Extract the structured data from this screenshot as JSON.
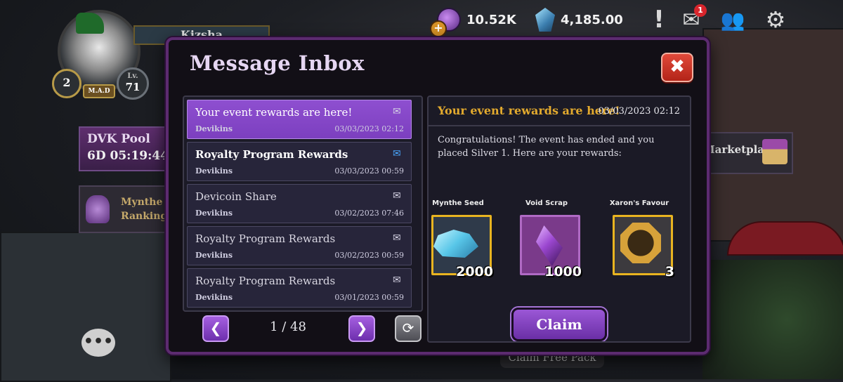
{
  "hud": {
    "currency1": "10.52K",
    "currency2": "4,185.00",
    "mail_badge": "1",
    "plus_symbol": "+"
  },
  "profile": {
    "name": "Kizsha",
    "rank": "2",
    "level_label": "Lv.",
    "level": "71",
    "guild": "M.A.D"
  },
  "side": {
    "dvk_title": "DVK Pool",
    "dvk_time": "6D 05:19:44",
    "mynthe_line1": "Mynthe",
    "mynthe_line2": "Ranking",
    "marketplace": "Marketplace"
  },
  "bottom": {
    "claim_free_pack": "Claim Free Pack"
  },
  "modal": {
    "title": "Message Inbox",
    "close_symbol": "✖",
    "pagination": {
      "current": 1,
      "total": 48,
      "label": "1 / 48",
      "prev": "❮",
      "next": "❯",
      "refresh": "⟳"
    },
    "messages": [
      {
        "title": "Your event rewards are here!",
        "sender": "Devikins",
        "date": "03/03/2023 02:12",
        "read": true,
        "active": true
      },
      {
        "title": "Royalty Program Rewards",
        "sender": "Devikins",
        "date": "03/03/2023 00:59",
        "read": false,
        "active": false
      },
      {
        "title": "Devicoin Share",
        "sender": "Devikins",
        "date": "03/02/2023 07:46",
        "read": true,
        "active": false
      },
      {
        "title": "Royalty Program Rewards",
        "sender": "Devikins",
        "date": "03/02/2023 00:59",
        "read": true,
        "active": false
      },
      {
        "title": "Royalty Program Rewards",
        "sender": "Devikins",
        "date": "03/01/2023 00:59",
        "read": true,
        "active": false
      }
    ],
    "detail": {
      "title": "Your event rewards are here!",
      "date": "03/03/2023 02:12",
      "body": "Congratulations! The event has ended and you placed Silver 1. Here are your rewards:",
      "rewards": [
        {
          "name": "Mynthe Seed",
          "count": "2000"
        },
        {
          "name": "Void Scrap",
          "count": "1000"
        },
        {
          "name": "Xaron's Favour",
          "count": "3"
        }
      ],
      "claim_label": "Claim"
    }
  },
  "icons": {
    "read_mail": "✉",
    "unread_mail": "✉",
    "alert": "!",
    "mail": "✉",
    "friends": "👥",
    "gear": "⚙",
    "chat": "•••"
  },
  "colors": {
    "accent_purple": "#8e4fd0",
    "gold_title": "#e3aa2e",
    "close_red": "#d1392a"
  }
}
